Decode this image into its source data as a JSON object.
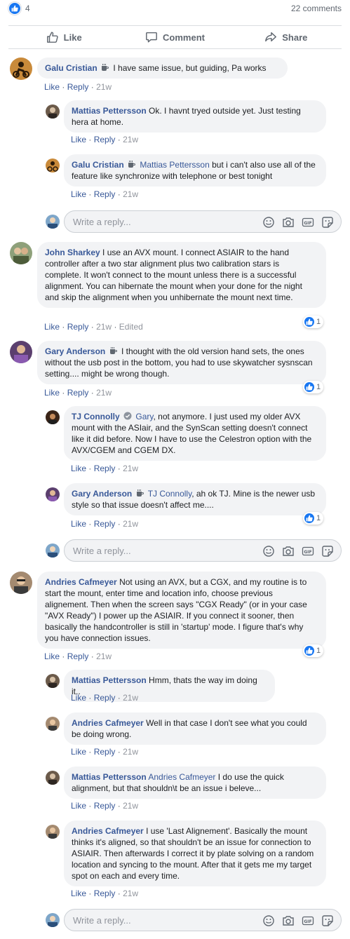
{
  "header": {
    "like_count": "4",
    "comments_count": "22 comments"
  },
  "actions": {
    "like": "Like",
    "comment": "Comment",
    "share": "Share"
  },
  "meta_labels": {
    "like": "Like",
    "reply": "Reply",
    "dot": "·",
    "edited": "Edited"
  },
  "reply_placeholder": "Write a reply...",
  "comments": [
    {
      "author": "Galu Cristian",
      "mention": "",
      "text": "I have same issue, but guiding, Pa works",
      "time": "21w",
      "reactions": ""
    },
    {
      "author": "Mattias Pettersson",
      "mention": "",
      "text": "Ok. I havnt tryed outside yet. Just testing hera at home.",
      "time": "21w",
      "reactions": ""
    },
    {
      "author": "Galu Cristian",
      "mention": "Mattias Pettersson",
      "text": "but i can't also use all of the feature like synchronize with telephone or best tonight",
      "time": "21w",
      "reactions": ""
    },
    {
      "author": "John Sharkey",
      "mention": "",
      "text": "I use an AVX mount. I connect ASIAIR to the hand controller after a two star alignment plus two calibration stars is complete. It won't connect to the mount unless there is a successful alignment. You can hibernate the mount when your done for the night and skip the alignment when you unhibernate the mount next time.",
      "time": "21w",
      "reactions": "1"
    },
    {
      "author": "Gary Anderson",
      "mention": "",
      "text": "I thought with the old version hand sets, the ones without the usb post in the bottom, you had to use skywatcher sysnscan setting.... might be wrong though.",
      "time": "21w",
      "reactions": "1"
    },
    {
      "author": "TJ Connolly",
      "mention": "Gary",
      "text": ", not anymore. I just used my older AVX mount with the ASIair, and the SynScan setting doesn't connect like it did before. Now I have to use the Celestron option with the AVX/CGEM and CGEM DX.",
      "time": "21w",
      "reactions": ""
    },
    {
      "author": "Gary Anderson",
      "mention": "TJ Connolly",
      "text": ", ah ok TJ. Mine is the newer usb style so that issue doesn't affect me....",
      "time": "21w",
      "reactions": "1"
    },
    {
      "author": "Andries Cafmeyer",
      "mention": "",
      "text": "Not using an AVX, but a CGX, and my routine is to start the mount, enter time and location info, choose previous alignement. Then when the screen says \"CGX Ready\" (or in your case \"AVX Ready\") I power up the ASIAIR. If you connect it sooner, then basically the handcontroller is still in 'startup' mode. I figure that's why you have connection issues.",
      "time": "21w",
      "reactions": "1"
    },
    {
      "author": "Mattias Pettersson",
      "mention": "",
      "text": "Hmm, thats the way im doing it..",
      "time": "21w",
      "reactions": ""
    },
    {
      "author": "Andries Cafmeyer",
      "mention": "",
      "text": "Well in that case I don't see what you could be doing wrong.",
      "time": "21w",
      "reactions": ""
    },
    {
      "author": "Mattias Pettersson",
      "mention": "Andries Cafmeyer",
      "text": "I do use the quick alignment, but that shouldn\\t be an issue i beleve...",
      "time": "21w",
      "reactions": ""
    },
    {
      "author": "Andries Cafmeyer",
      "mention": "",
      "text": "I use 'Last Alignement'. Basically the mount thinks it's aligned, so that shouldn't be an issue for connection to ASIAIR. Then afterwards I correct it by plate solving on a random location and syncing to the mount. After that it gets me my target spot on each and every time.",
      "time": "21w",
      "reactions": ""
    }
  ],
  "colors": {
    "link": "#385898",
    "bubble": "#f2f3f5",
    "brand": "#1877f2",
    "meta_gray": "#90949c"
  }
}
